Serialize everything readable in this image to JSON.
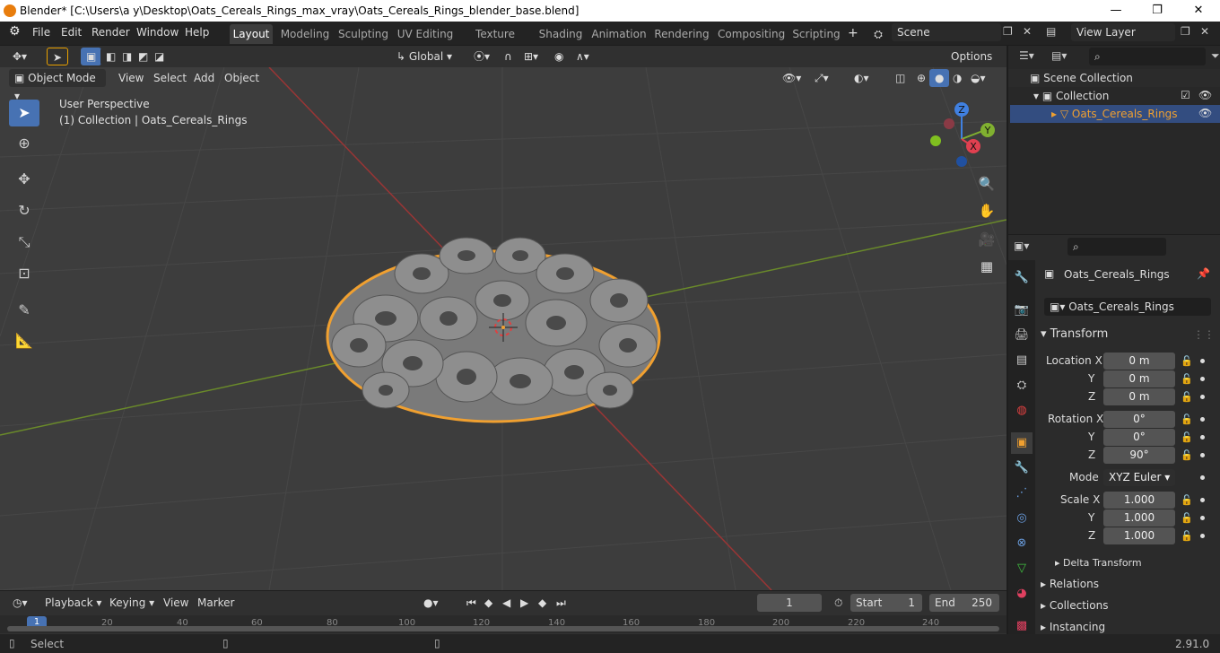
{
  "titlebar": {
    "title": "Blender* [C:\\Users\\a y\\Desktop\\Oats_Cereals_Rings_max_vray\\Oats_Cereals_Rings_blender_base.blend]",
    "minimize": "—",
    "maximize": "❐",
    "close": "✕"
  },
  "menu": [
    "File",
    "Edit",
    "Render",
    "Window",
    "Help"
  ],
  "workspaces": [
    "Layout",
    "Modeling",
    "Sculpting",
    "UV Editing",
    "Texture Paint",
    "Shading",
    "Animation",
    "Rendering",
    "Compositing",
    "Scripting"
  ],
  "scene": "Scene",
  "view_layer": "View Layer",
  "header": {
    "transform_orientation": "Global",
    "options": "Options"
  },
  "viewport_header": {
    "mode": "Object Mode",
    "items": [
      "View",
      "Select",
      "Add",
      "Object"
    ]
  },
  "overlay_text": {
    "perspective": "User Perspective",
    "collection": "(1) Collection | Oats_Cereals_Rings"
  },
  "gizmo": {
    "x": "X",
    "y": "Y",
    "z": "Z"
  },
  "outliner": {
    "scene_collection": "Scene Collection",
    "collection": "Collection",
    "object": "Oats_Cereals_Rings"
  },
  "properties": {
    "object_name": "Oats_Cereals_Rings",
    "data_name": "Oats_Cereals_Rings",
    "transform_label": "Transform",
    "location_label": "Location X",
    "rotation_label": "Rotation X",
    "scale_label": "Scale X",
    "y": "Y",
    "z": "Z",
    "location": [
      "0 m",
      "0 m",
      "0 m"
    ],
    "rotation": [
      "0°",
      "0°",
      "90°"
    ],
    "mode_label": "Mode",
    "mode": "XYZ Euler",
    "scale": [
      "1.000",
      "1.000",
      "1.000"
    ],
    "delta": "Delta Transform",
    "sections": [
      "Relations",
      "Collections",
      "Instancing"
    ]
  },
  "timeline": {
    "menus": [
      "Playback",
      "Keying",
      "View",
      "Marker"
    ],
    "current_frame": "1",
    "start_label": "Start",
    "start": "1",
    "end_label": "End",
    "end": "250",
    "ruler": [
      "1",
      "20",
      "40",
      "60",
      "80",
      "100",
      "120",
      "140",
      "160",
      "180",
      "200",
      "220",
      "240"
    ]
  },
  "status": {
    "select": "Select",
    "version": "2.91.0"
  }
}
